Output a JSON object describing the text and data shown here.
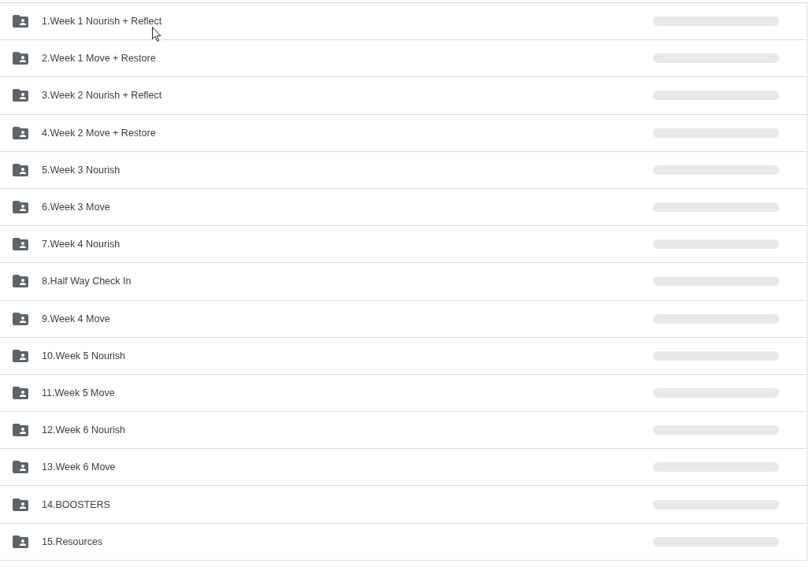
{
  "folders": [
    {
      "name": "1.Week 1 Nourish + Reflect",
      "loading": true
    },
    {
      "name": "2.Week 1 Move + Restore",
      "loading": true
    },
    {
      "name": "3.Week 2 Nourish + Reflect",
      "loading": true
    },
    {
      "name": "4.Week 2 Move + Restore",
      "loading": true
    },
    {
      "name": "5.Week 3 Nourish",
      "loading": true
    },
    {
      "name": "6.Week 3 Move",
      "loading": true
    },
    {
      "name": "7.Week 4 Nourish",
      "loading": true
    },
    {
      "name": "8.Half Way Check In",
      "loading": true
    },
    {
      "name": "9.Week 4 Move",
      "loading": true
    },
    {
      "name": "10.Week 5 Nourish",
      "loading": true
    },
    {
      "name": "11.Week 5 Move",
      "loading": true
    },
    {
      "name": "12.Week 6 Nourish",
      "loading": true
    },
    {
      "name": "13.Week 6 Move",
      "loading": true
    },
    {
      "name": "14.BOOSTERS",
      "loading": true
    },
    {
      "name": "15.Resources",
      "loading": true
    }
  ]
}
